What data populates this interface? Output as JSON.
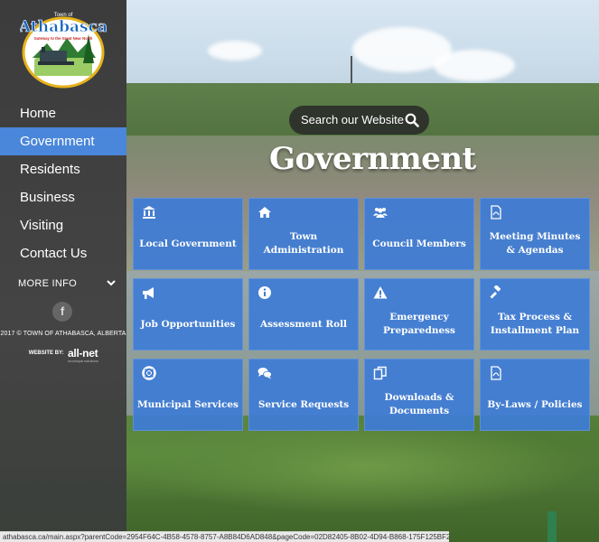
{
  "logo": {
    "top_text": "Town of",
    "name": "Athabasca",
    "tagline": "Gateway to the Great Near North"
  },
  "sidebar": {
    "items": [
      {
        "label": "Home",
        "active": false
      },
      {
        "label": "Government",
        "active": true
      },
      {
        "label": "Residents",
        "active": false
      },
      {
        "label": "Business",
        "active": false
      },
      {
        "label": "Visiting",
        "active": false
      },
      {
        "label": "Contact Us",
        "active": false
      }
    ],
    "more_info": "MORE INFO",
    "facebook": "f",
    "copyright": "2017 © TOWN OF ATHABASCA, ALBERTA",
    "website_by": "WEBSITE BY:",
    "vendor": "all-net",
    "vendor_sub": "municipal solutions"
  },
  "search": {
    "label": "Search our Website"
  },
  "page_title": "Government",
  "tiles": [
    {
      "label": "Local Government",
      "icon": "bank-icon"
    },
    {
      "label": "Town Administration",
      "icon": "home-icon"
    },
    {
      "label": "Council Members",
      "icon": "users-icon"
    },
    {
      "label": "Meeting Minutes & Agendas",
      "icon": "pdf-icon"
    },
    {
      "label": "Job Opportunities",
      "icon": "bullhorn-icon"
    },
    {
      "label": "Assessment Roll",
      "icon": "info-icon"
    },
    {
      "label": "Emergency Preparedness",
      "icon": "warning-icon"
    },
    {
      "label": "Tax Process & Installment Plan",
      "icon": "gavel-icon"
    },
    {
      "label": "Municipal Services",
      "icon": "lifering-icon"
    },
    {
      "label": "Service Requests",
      "icon": "chat-icon"
    },
    {
      "label": "Downloads & Documents",
      "icon": "copy-icon"
    },
    {
      "label": "By-Laws / Policies",
      "icon": "pdf-icon"
    }
  ],
  "status_url": "athabasca.ca/main.aspx?parentCode=2954F64C-4B58-4578-8757-A8B84D6AD848&pageCode=02D82405-8B02-4D94-B868-175F125BF25A",
  "colors": {
    "accent": "#4a86d9",
    "tile": "#3e7cd6",
    "sidebar": "#3c3c3c"
  }
}
